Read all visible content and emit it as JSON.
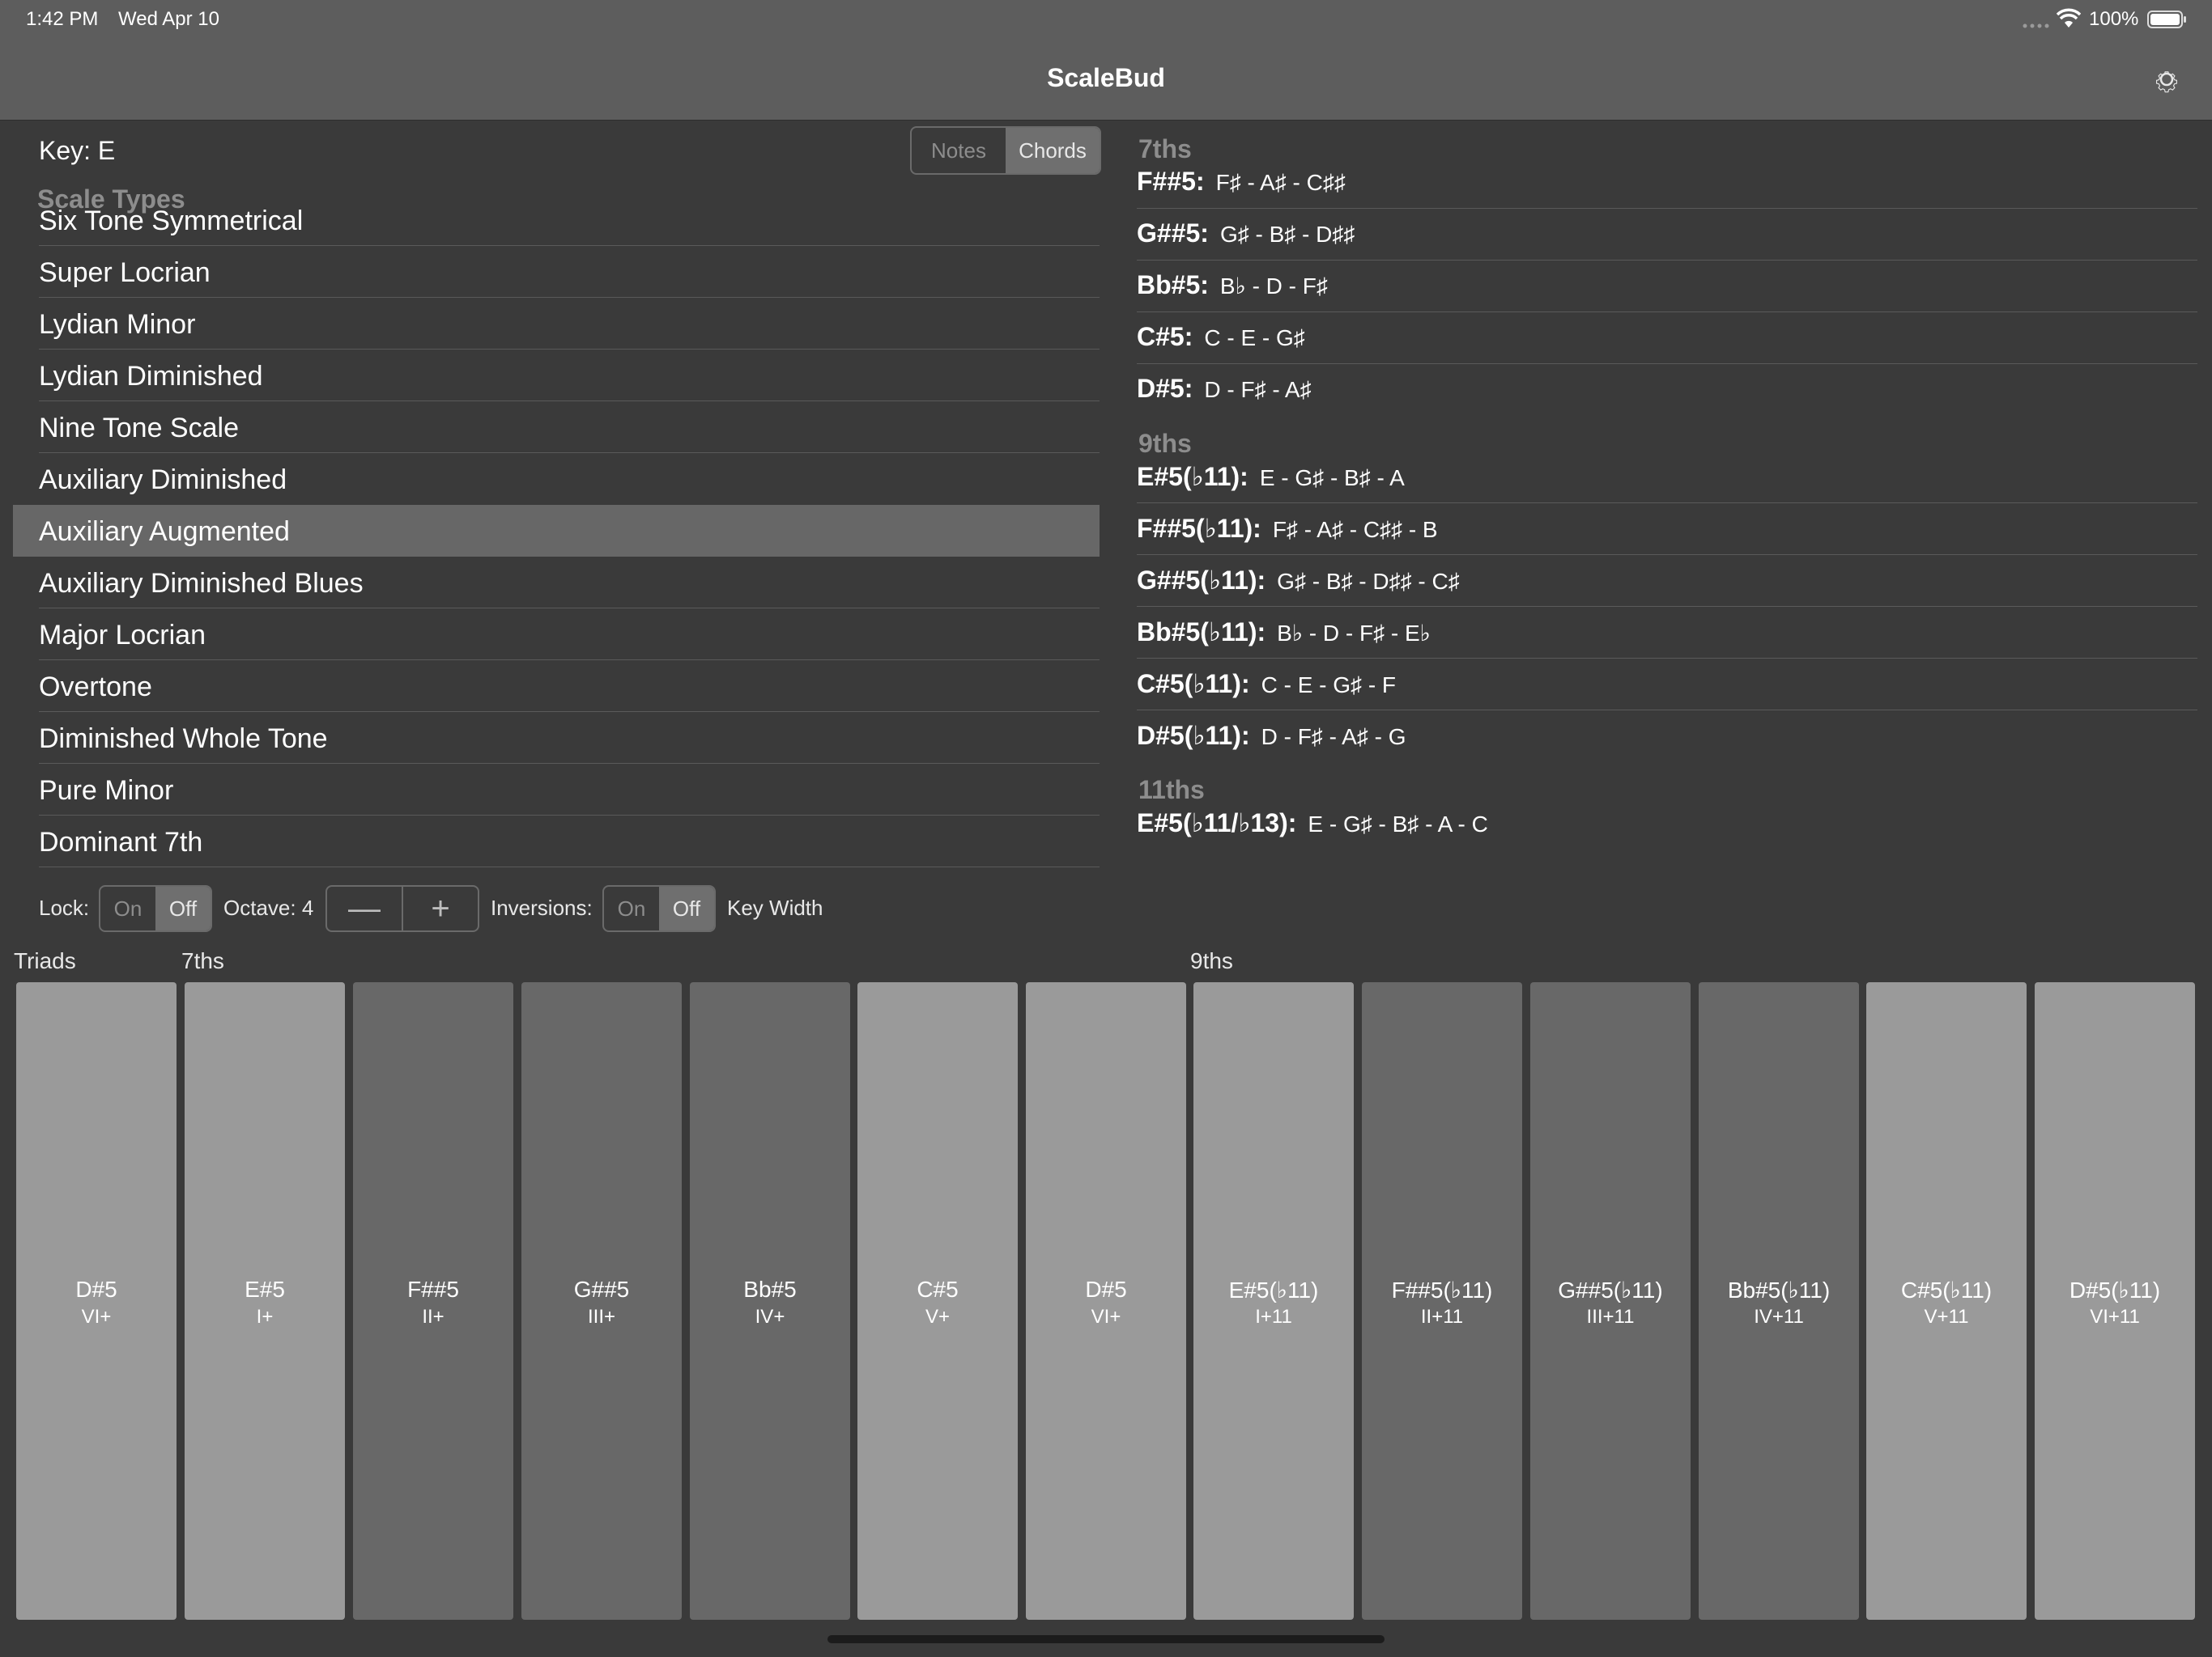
{
  "status_bar": {
    "time": "1:42 PM",
    "date": "Wed Apr 10",
    "battery": "100%"
  },
  "nav": {
    "title": "ScaleBud"
  },
  "key_label": "Key: E",
  "view_toggle": {
    "options": [
      "Notes",
      "Chords"
    ],
    "selected": "Chords"
  },
  "scale_types": {
    "header": "Scale Types",
    "items": [
      "Six Tone Symmetrical",
      "Super Locrian",
      "Lydian Minor",
      "Lydian Diminished",
      "Nine Tone Scale",
      "Auxiliary Diminished",
      "Auxiliary Augmented",
      "Auxiliary Diminished Blues",
      "Major Locrian",
      "Overtone",
      "Diminished Whole Tone",
      "Pure Minor",
      "Dominant 7th"
    ],
    "selected": "Auxiliary Augmented"
  },
  "controls": {
    "lock_label": "Lock:",
    "lock_options": [
      "On",
      "Off"
    ],
    "lock_selected": "Off",
    "octave_label": "Octave: 4",
    "octave_minus": "—",
    "octave_plus": "+",
    "inversions_label": "Inversions:",
    "inversions_options": [
      "On",
      "Off"
    ],
    "inversions_selected": "Off",
    "key_width_label": "Key Width"
  },
  "chords": {
    "sevenths": {
      "header": "7ths",
      "rows": [
        {
          "name": "F##5:",
          "notes": "F♯ - A♯ - C♯♯"
        },
        {
          "name": "G##5:",
          "notes": "G♯ - B♯ - D♯♯"
        },
        {
          "name": "Bb#5:",
          "notes": "B♭ - D - F♯"
        },
        {
          "name": "C#5:",
          "notes": "C - E - G♯"
        },
        {
          "name": "D#5:",
          "notes": "D - F♯ - A♯"
        }
      ]
    },
    "ninths": {
      "header": "9ths",
      "rows": [
        {
          "name": "E#5(♭11):",
          "notes": "E - G♯ - B♯ - A"
        },
        {
          "name": "F##5(♭11):",
          "notes": "F♯ - A♯ - C♯♯ - B"
        },
        {
          "name": "G##5(♭11):",
          "notes": "G♯ - B♯ - D♯♯ - C♯"
        },
        {
          "name": "Bb#5(♭11):",
          "notes": "B♭ - D - F♯ - E♭"
        },
        {
          "name": "C#5(♭11):",
          "notes": "C - E - G♯ - F"
        },
        {
          "name": "D#5(♭11):",
          "notes": "D - F♯ - A♯ - G"
        }
      ]
    },
    "elevenths": {
      "header": "11ths",
      "rows": [
        {
          "name": "E#5(♭11/♭13):",
          "notes": "E - G♯ - B♯ - A - C"
        }
      ]
    }
  },
  "keyboard": {
    "groups": [
      "Triads",
      "7ths",
      "9ths"
    ],
    "keys": [
      {
        "name": "D#5",
        "roman": "VI+",
        "shade": "light"
      },
      {
        "name": "E#5",
        "roman": "I+",
        "shade": "light"
      },
      {
        "name": "F##5",
        "roman": "II+",
        "shade": "dark"
      },
      {
        "name": "G##5",
        "roman": "III+",
        "shade": "dark"
      },
      {
        "name": "Bb#5",
        "roman": "IV+",
        "shade": "dark"
      },
      {
        "name": "C#5",
        "roman": "V+",
        "shade": "light"
      },
      {
        "name": "D#5",
        "roman": "VI+",
        "shade": "light"
      },
      {
        "name": "E#5(♭11)",
        "roman": "I+11",
        "shade": "light"
      },
      {
        "name": "F##5(♭11)",
        "roman": "II+11",
        "shade": "dark"
      },
      {
        "name": "G##5(♭11)",
        "roman": "III+11",
        "shade": "dark"
      },
      {
        "name": "Bb#5(♭11)",
        "roman": "IV+11",
        "shade": "dark"
      },
      {
        "name": "C#5(♭11)",
        "roman": "V+11",
        "shade": "light"
      },
      {
        "name": "D#5(♭11)",
        "roman": "VI+11",
        "shade": "light"
      }
    ]
  },
  "icons": {
    "settings": "gear-icon",
    "wifi": "wifi-icon",
    "battery": "battery-icon",
    "signal": "signal-dots-icon"
  }
}
